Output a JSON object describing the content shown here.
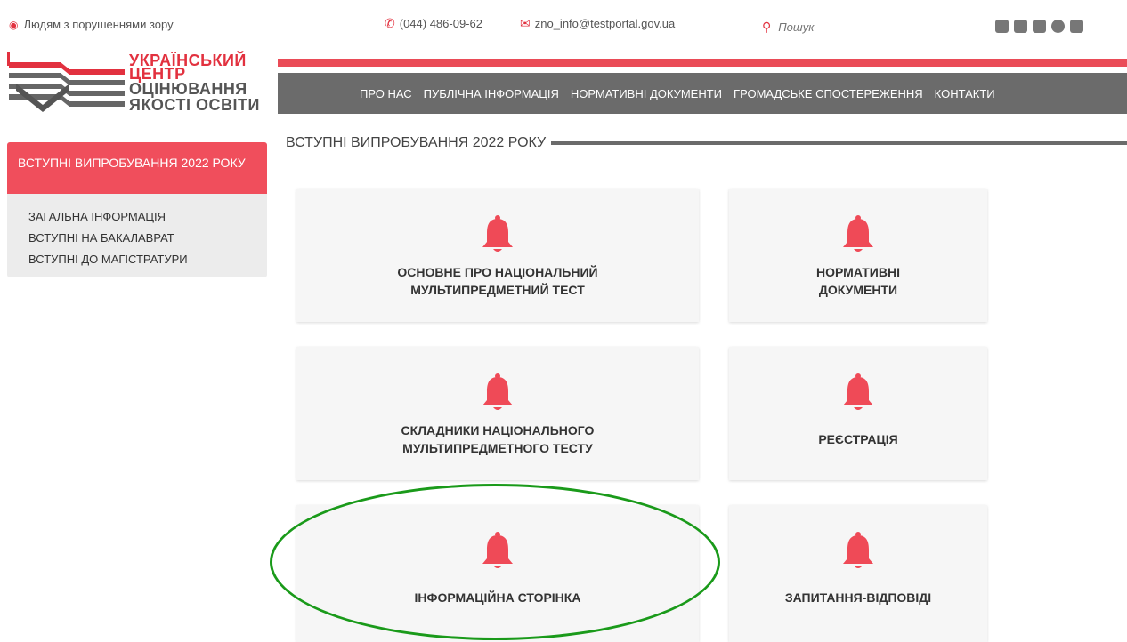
{
  "topbar": {
    "accessibility_label": "Людям з порушеннями зору",
    "phone": "(044) 486-09-62",
    "email": "zno_info@testportal.gov.ua",
    "search_placeholder": "Пошук",
    "socials": [
      "rss-icon",
      "instagram-icon",
      "facebook-icon",
      "telegram-icon",
      "youtube-icon"
    ]
  },
  "logo": {
    "line1": "УКРАЇНСЬКИЙ",
    "line2": "ЦЕНТР",
    "line3": "ОЦІНЮВАННЯ",
    "line4": "ЯКОСТІ ОСВІТИ"
  },
  "nav": {
    "items": [
      "ПРО НАС",
      "ПУБЛІЧНА ІНФОРМАЦІЯ",
      "НОРМАТИВНІ ДОКУМЕНТИ",
      "ГРОМАДСЬКЕ СПОСТЕРЕЖЕННЯ",
      "КОНТАКТИ"
    ]
  },
  "sidebar": {
    "active_label": "ВСТУПНІ ВИПРОБУВАННЯ 2022 РОКУ",
    "items": [
      "ЗАГАЛЬНА ІНФОРМАЦІЯ",
      "ВСТУПНІ НА БАКАЛАВРАТ",
      "ВСТУПНІ ДО МАГІСТРАТУРИ"
    ]
  },
  "main": {
    "title": "ВСТУПНІ ВИПРОБУВАННЯ 2022 РОКУ",
    "cards": [
      {
        "line1": "ОСНОВНЕ ПРО НАЦІОНАЛЬНИЙ",
        "line2": "МУЛЬТИПРЕДМЕТНИЙ ТЕСТ"
      },
      {
        "line1": "НОРМАТИВНІ",
        "line2": "ДОКУМЕНТИ"
      },
      {
        "line1": "СКЛАДНИКИ НАЦІОНАЛЬНОГО",
        "line2": "МУЛЬТИПРЕДМЕТНОГО ТЕСТУ"
      },
      {
        "line1": "РЕЄСТРАЦІЯ",
        "line2": ""
      },
      {
        "line1": "ІНФОРМАЦІЙНА СТОРІНКА",
        "line2": ""
      },
      {
        "line1": "ЗАПИТАННЯ-ВІДПОВІДІ",
        "line2": ""
      }
    ]
  },
  "colors": {
    "accent": "#e2313f",
    "nav_bg": "#6b6b6b",
    "card_bg": "#f6f6f6",
    "highlight": "#1a9a1a"
  }
}
